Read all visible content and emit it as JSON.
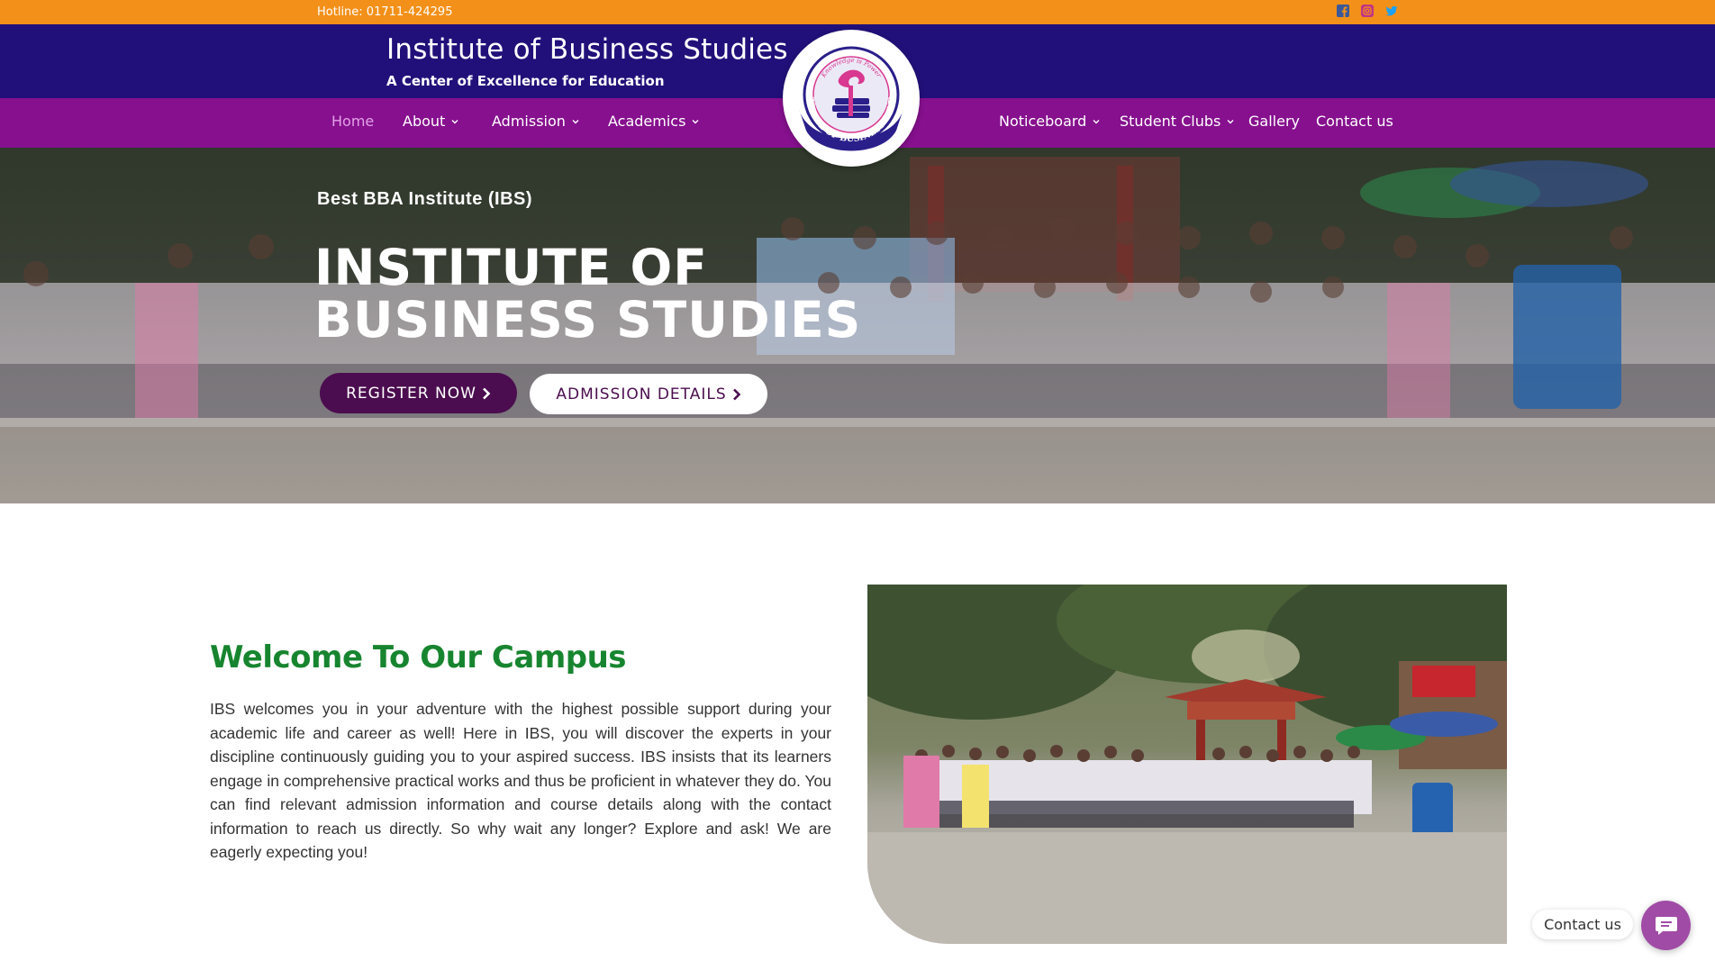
{
  "topbar": {
    "hotline": "Hotline: 01711-424295",
    "social": [
      {
        "icon": "facebook-icon",
        "color": "#3b5998"
      },
      {
        "icon": "instagram-icon",
        "color": "#c13584"
      },
      {
        "icon": "twitter-icon",
        "color": "#1da1f2"
      }
    ]
  },
  "header": {
    "title": "Institute of Business Studies",
    "subtitle": "A Center of Excellence for Education",
    "logo": {
      "ring_text": "INSTITUTE OF BUSINESS STUDIES",
      "motto": "Knowledge is Power"
    }
  },
  "nav": {
    "home": "Home",
    "about": "About",
    "admission": "Admission",
    "academics": "Academics",
    "noticeboard": "Noticeboard",
    "student_clubs": "Student Clubs",
    "gallery": "Gallery",
    "contact": "Contact us"
  },
  "hero": {
    "tagline": "Best BBA Institute (IBS)",
    "title_line1": "INSTITUTE OF",
    "title_line2": "BUSINESS STUDIES",
    "register_label": "REGISTER NOW",
    "admission_label": "ADMISSION DETAILS"
  },
  "welcome": {
    "title": "Welcome To Our Campus",
    "body": "IBS welcomes you in your adventure with the highest possible support during your academic life and career as well! Here in IBS, you will discover the experts in your discipline continuously guiding you to your aspired success. IBS insists that its learners engage in comprehensive practical works and thus be proficient in whatever they do. You can find relevant admission information and course details along with the contact information to reach us directly. So why wait any longer? Explore and ask! We are eagerly expecting you!"
  },
  "contact_widget": {
    "label": "Contact us"
  },
  "colors": {
    "topbar": "#f39019",
    "title_band": "#22107a",
    "nav": "#86108e",
    "accent_green": "#17852f",
    "button_dark": "#4b0d4f"
  }
}
